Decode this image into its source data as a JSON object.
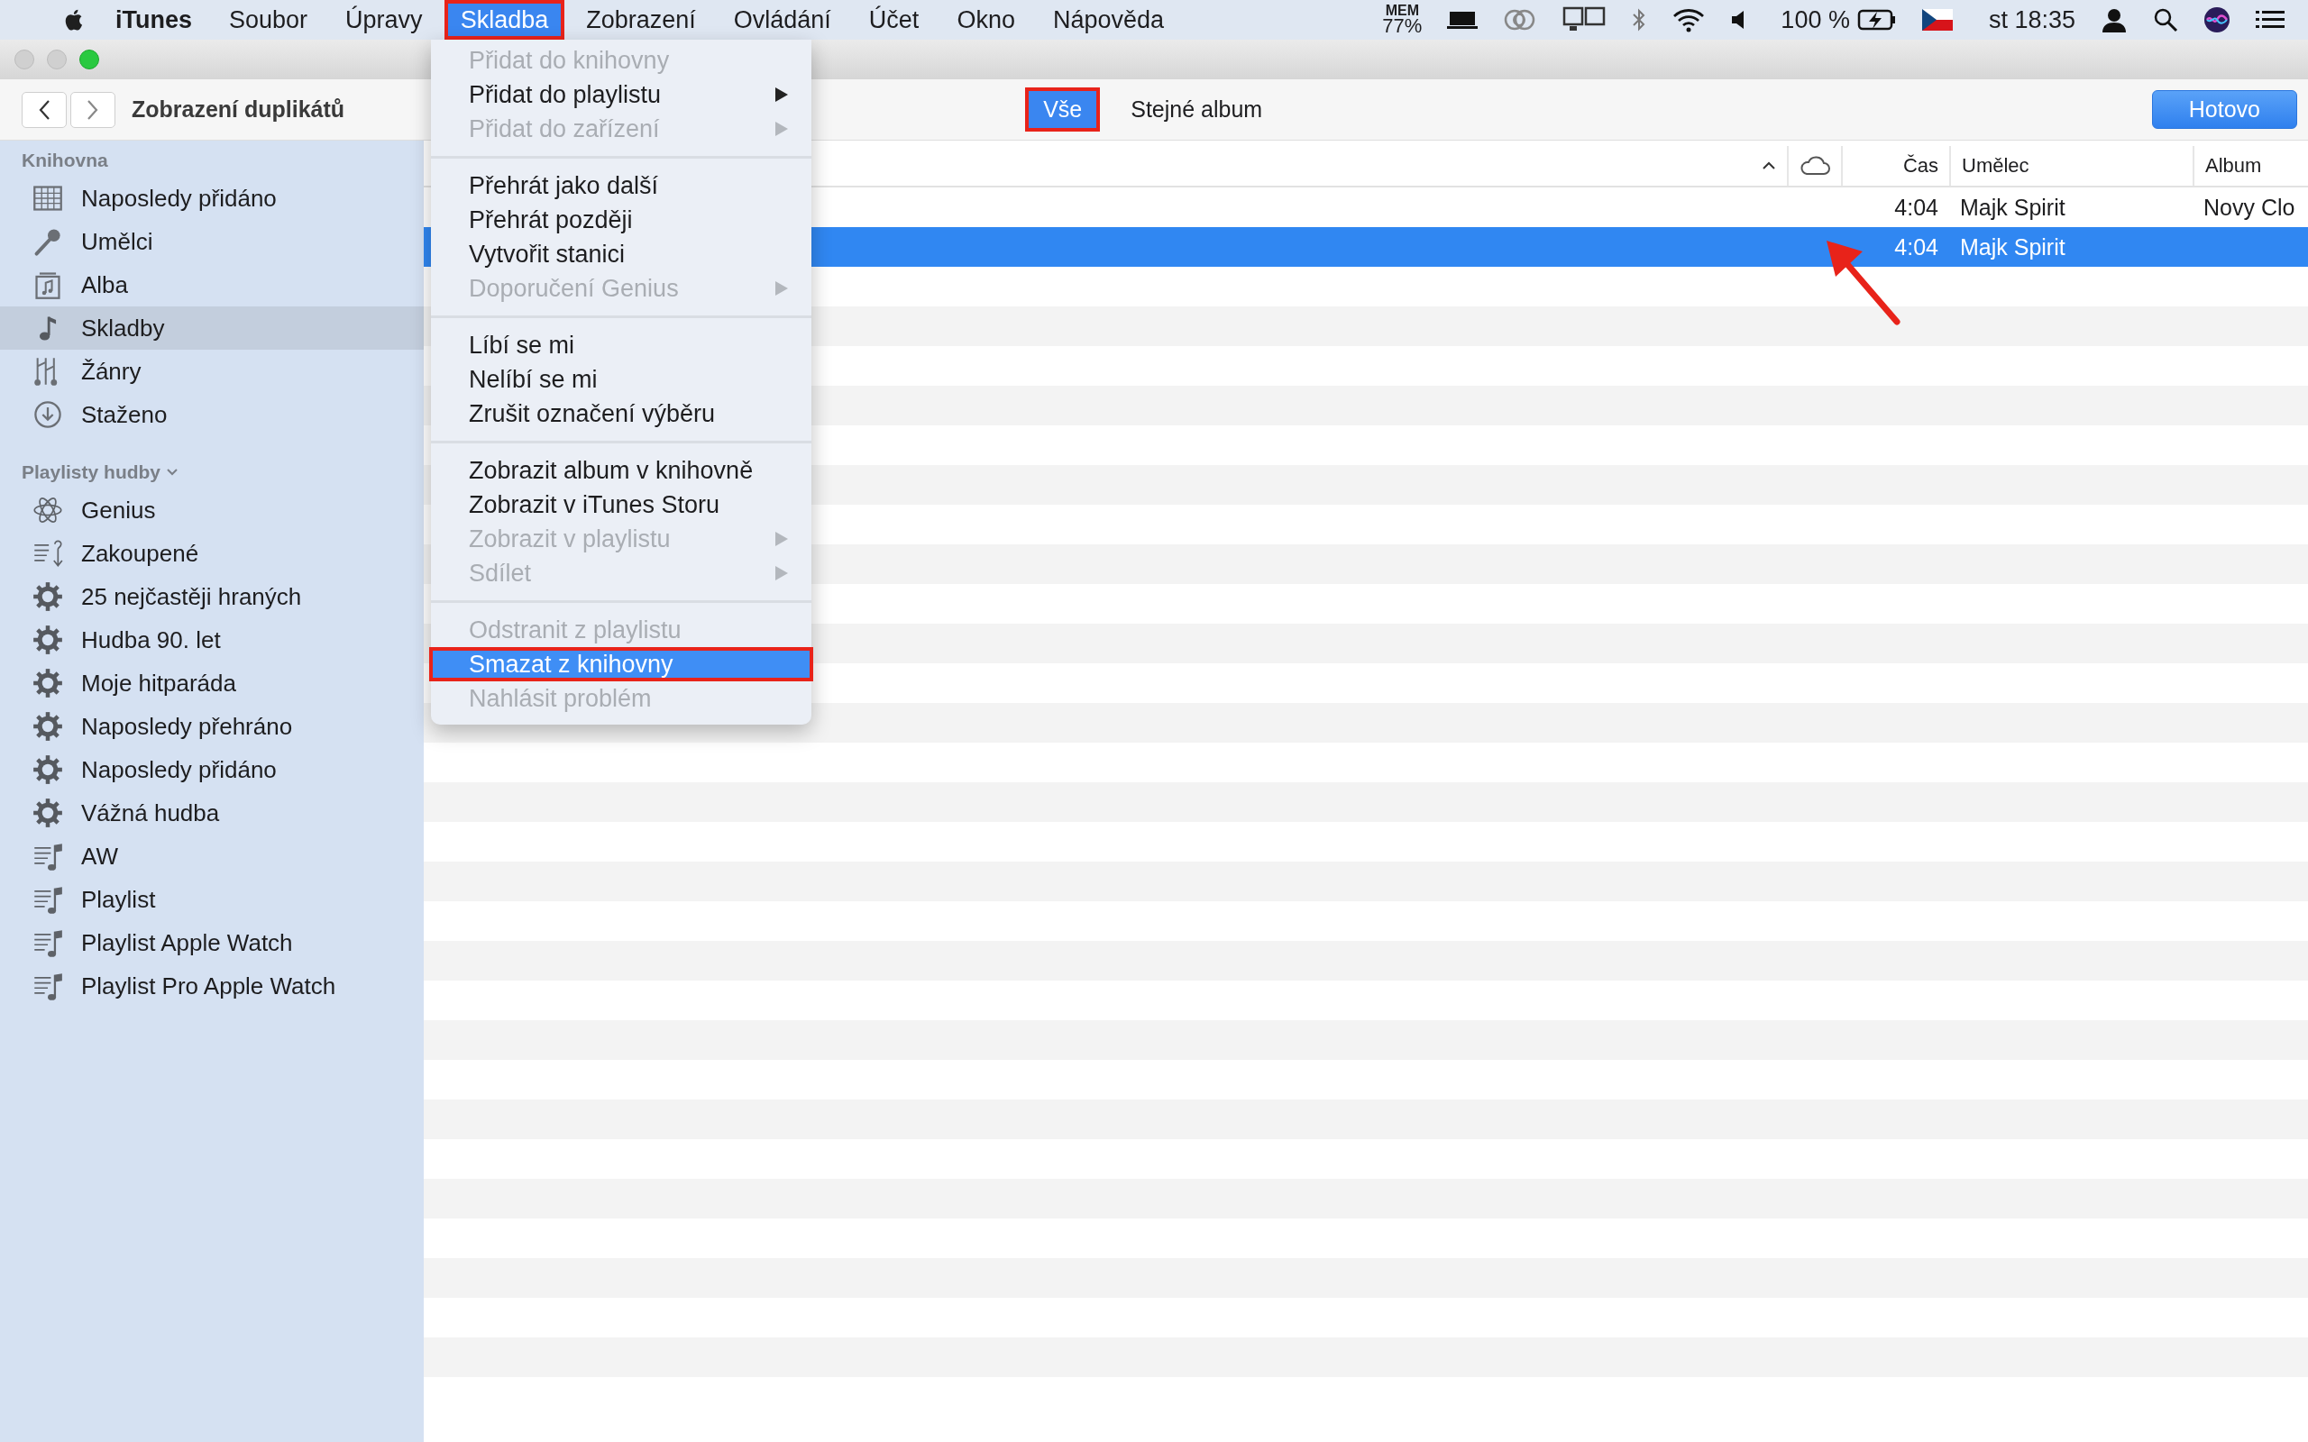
{
  "menu_bar": {
    "app_name": "iTunes",
    "menus": [
      {
        "label": "Soubor",
        "selected": false,
        "annotated": false
      },
      {
        "label": "Úpravy",
        "selected": false,
        "annotated": false
      },
      {
        "label": "Skladba",
        "selected": true,
        "annotated": true
      },
      {
        "label": "Zobrazení",
        "selected": false,
        "annotated": false
      },
      {
        "label": "Ovládání",
        "selected": false,
        "annotated": false
      },
      {
        "label": "Účet",
        "selected": false,
        "annotated": false
      },
      {
        "label": "Okno",
        "selected": false,
        "annotated": false
      },
      {
        "label": "Nápověda",
        "selected": false,
        "annotated": false
      }
    ],
    "memory": {
      "label": "MEM",
      "value": "77%"
    },
    "battery": "100 %",
    "clock": "st 18:35"
  },
  "window": {
    "title": "Zobrazení duplikátů"
  },
  "filter": [
    {
      "label": "Vše",
      "selected": true,
      "annotated": true
    },
    {
      "label": "Stejné album",
      "selected": false,
      "annotated": false
    }
  ],
  "done_button": "Hotovo",
  "sidebar": {
    "sections": [
      {
        "title": "Knihovna",
        "collapsible": false,
        "items": [
          {
            "label": "Naposledy přidáno",
            "kind": "grid",
            "selected": false
          },
          {
            "label": "Umělci",
            "kind": "mic",
            "selected": false
          },
          {
            "label": "Alba",
            "kind": "album",
            "selected": false
          },
          {
            "label": "Skladby",
            "kind": "note",
            "selected": true
          },
          {
            "label": "Žánry",
            "kind": "genres",
            "selected": false
          },
          {
            "label": "Staženo",
            "kind": "download",
            "selected": false
          }
        ]
      },
      {
        "title": "Playlisty hudby",
        "collapsible": true,
        "items": [
          {
            "label": "Genius",
            "kind": "atom",
            "selected": false
          },
          {
            "label": "Zakoupené",
            "kind": "purchased",
            "selected": false
          },
          {
            "label": "25 nejčastěji hraných",
            "kind": "smart",
            "selected": false
          },
          {
            "label": "Hudba 90. let",
            "kind": "smart",
            "selected": false
          },
          {
            "label": "Moje hitparáda",
            "kind": "smart",
            "selected": false
          },
          {
            "label": "Naposledy přehráno",
            "kind": "smart",
            "selected": false
          },
          {
            "label": "Naposledy přidáno",
            "kind": "smart",
            "selected": false
          },
          {
            "label": "Vážná hudba",
            "kind": "smart",
            "selected": false
          },
          {
            "label": "AW",
            "kind": "playlist",
            "selected": false
          },
          {
            "label": "Playlist",
            "kind": "playlist",
            "selected": false
          },
          {
            "label": "Playlist Apple Watch",
            "kind": "playlist",
            "selected": false
          },
          {
            "label": "Playlist Pro Apple Watch",
            "kind": "playlist",
            "selected": false
          }
        ]
      }
    ]
  },
  "table": {
    "columns": [
      "Čas",
      "Umělec",
      "Album"
    ],
    "rows": [
      {
        "time": "4:04",
        "artist": "Majk Spirit",
        "album": "Novy Clo",
        "selected": false
      },
      {
        "time": "4:04",
        "artist": "Majk Spirit",
        "selected": true
      }
    ]
  },
  "context_menu": {
    "groups": [
      [
        {
          "label": "Přidat do knihovny",
          "disabled": true,
          "submenu": false,
          "selected": false,
          "annotated": false
        },
        {
          "label": "Přidat do playlistu",
          "disabled": false,
          "submenu": true,
          "selected": false,
          "annotated": false
        },
        {
          "label": "Přidat do zařízení",
          "disabled": true,
          "submenu": true,
          "selected": false,
          "annotated": false
        }
      ],
      [
        {
          "label": "Přehrát jako další",
          "disabled": false,
          "submenu": false,
          "selected": false,
          "annotated": false
        },
        {
          "label": "Přehrát později",
          "disabled": false,
          "submenu": false,
          "selected": false,
          "annotated": false
        },
        {
          "label": "Vytvořit stanici",
          "disabled": false,
          "submenu": false,
          "selected": false,
          "annotated": false
        },
        {
          "label": "Doporučení Genius",
          "disabled": true,
          "submenu": true,
          "selected": false,
          "annotated": false
        }
      ],
      [
        {
          "label": "Líbí se mi",
          "disabled": false,
          "submenu": false,
          "selected": false,
          "annotated": false
        },
        {
          "label": "Nelíbí se mi",
          "disabled": false,
          "submenu": false,
          "selected": false,
          "annotated": false
        },
        {
          "label": "Zrušit označení výběru",
          "disabled": false,
          "submenu": false,
          "selected": false,
          "annotated": false
        }
      ],
      [
        {
          "label": "Zobrazit album v knihovně",
          "disabled": false,
          "submenu": false,
          "selected": false,
          "annotated": false
        },
        {
          "label": "Zobrazit v iTunes Storu",
          "disabled": false,
          "submenu": false,
          "selected": false,
          "annotated": false
        },
        {
          "label": "Zobrazit v playlistu",
          "disabled": true,
          "submenu": true,
          "selected": false,
          "annotated": false
        },
        {
          "label": "Sdílet",
          "disabled": true,
          "submenu": true,
          "selected": false,
          "annotated": false
        }
      ],
      [
        {
          "label": "Odstranit z playlistu",
          "disabled": true,
          "submenu": false,
          "selected": false,
          "annotated": false
        },
        {
          "label": "Smazat z knihovny",
          "disabled": false,
          "submenu": false,
          "selected": true,
          "annotated": true
        },
        {
          "label": "Nahlásit problém",
          "disabled": true,
          "submenu": false,
          "selected": false,
          "annotated": false
        }
      ]
    ]
  }
}
